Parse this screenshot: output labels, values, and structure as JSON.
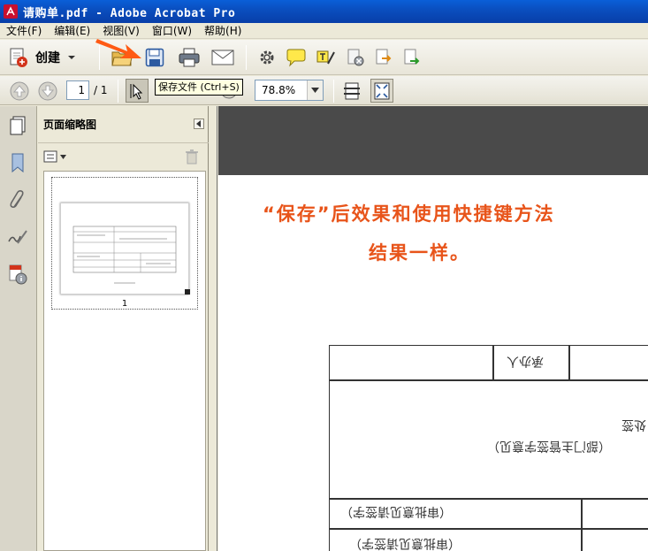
{
  "window": {
    "title": "请购单.pdf - Adobe Acrobat Pro"
  },
  "menu": [
    {
      "label": "文件(F)"
    },
    {
      "label": "编辑(E)"
    },
    {
      "label": "视图(V)"
    },
    {
      "label": "窗口(W)"
    },
    {
      "label": "帮助(H)"
    }
  ],
  "toolbar": {
    "create_label": "创建",
    "tooltip": "保存文件 (Ctrl+S)"
  },
  "nav": {
    "current_page": "1",
    "total_pages": "/ 1",
    "zoom": "78.8%"
  },
  "panel": {
    "title": "页面缩略图",
    "thumb_label": "1"
  },
  "document": {
    "annotation_line1": "“保存”后效果和使用快捷键方法",
    "annotation_line2": "结果一样。",
    "mirrored_1": "承办人",
    "mirrored_2": "（部门主管签字意见）",
    "mirrored_3": "处签",
    "mirrored_4": "（审批意见请签字）",
    "mirrored_5": "（审批意见请签字）"
  },
  "colors": {
    "title_bar": "#0a4fc0",
    "annotation": "#e8541a",
    "arrow": "#ff5a14"
  }
}
